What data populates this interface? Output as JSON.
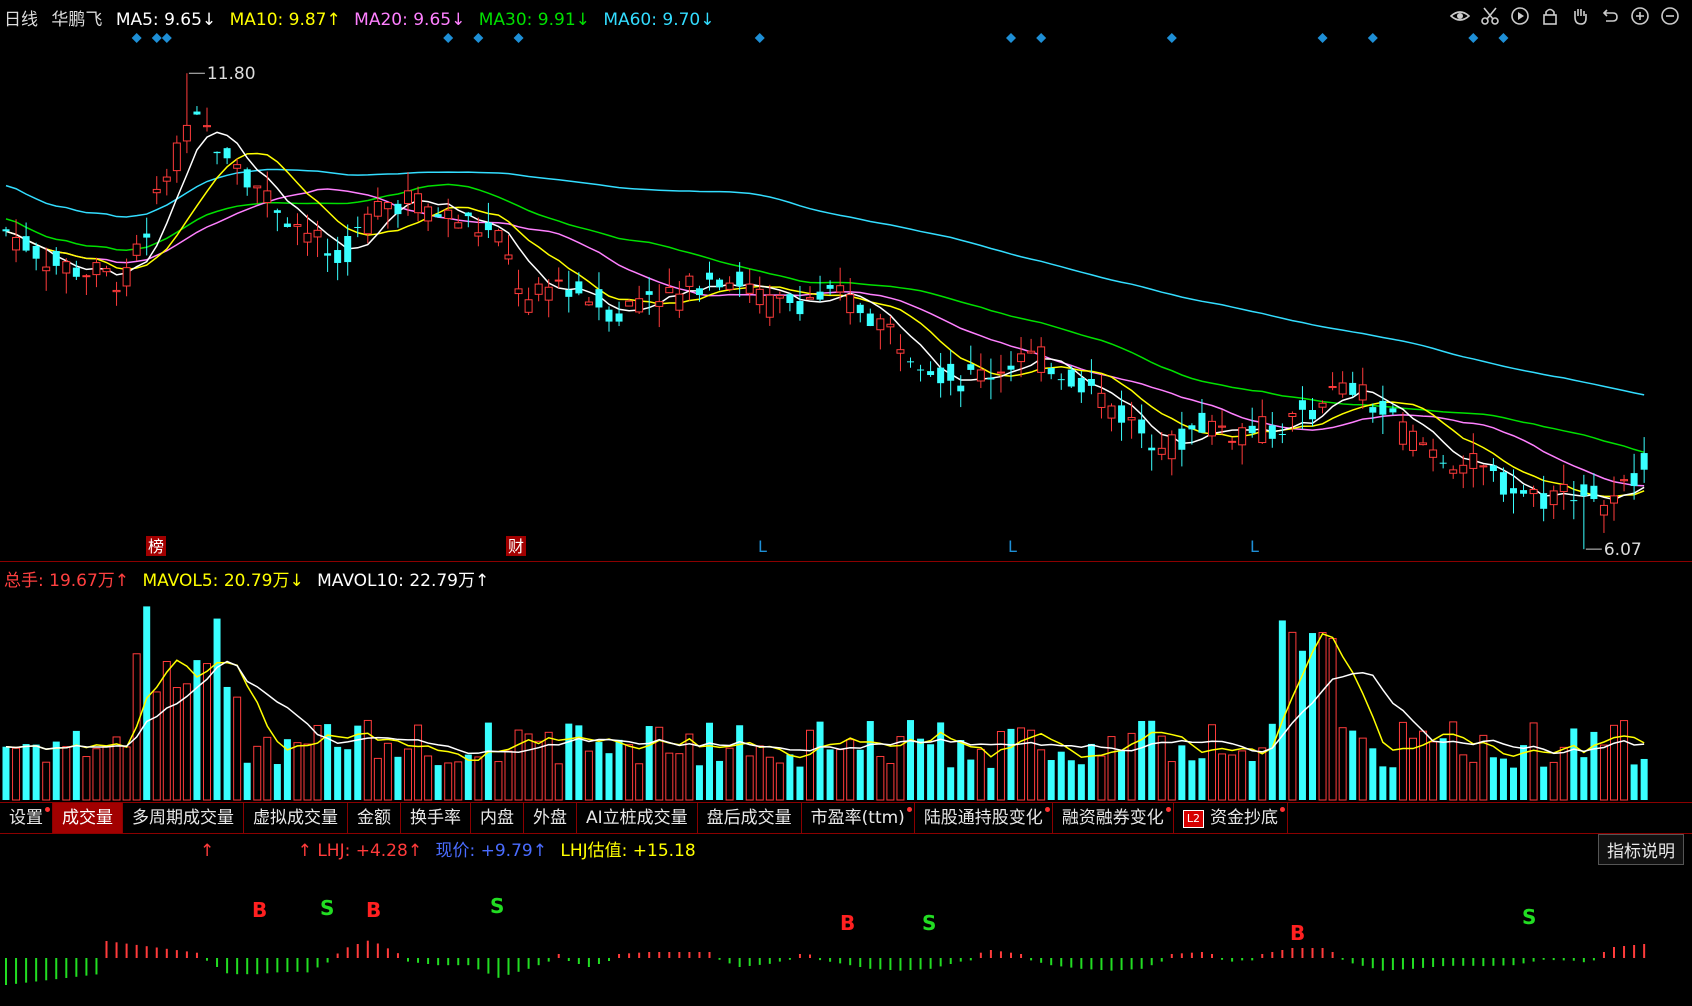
{
  "colors": {
    "up": "#ff3b3b",
    "down": "#39ffff",
    "ma5": "#ffffff",
    "ma10": "#ffff00",
    "ma20": "#ff80ff",
    "ma30": "#00e000",
    "ma60": "#33ddff",
    "vol_ma5": "#ffff00",
    "vol_ma10": "#ffffff",
    "diamond": "#1e8fd6",
    "lhj_up": "#ff3b3b",
    "lhj_down": "#22dd22",
    "price_text": "#4a6cff",
    "estimate_text": "#ffff00"
  },
  "header": {
    "period": "日线",
    "stock_name": "华鹏飞",
    "ma": [
      {
        "label": "MA5:",
        "value": "9.65↓"
      },
      {
        "label": "MA10:",
        "value": "9.87↑"
      },
      {
        "label": "MA20:",
        "value": "9.65↓"
      },
      {
        "label": "MA30:",
        "value": "9.91↓"
      },
      {
        "label": "MA60:",
        "value": "9.70↓"
      }
    ]
  },
  "toolbar": [
    "eye-icon",
    "scissors-icon",
    "play-icon",
    "lock-icon",
    "hand-icon",
    "undo-icon",
    "zoom-in-icon",
    "zoom-out-icon"
  ],
  "price_chart": {
    "high_label": "11.80",
    "low_label": "6.07",
    "markers": [
      "榜",
      "财",
      "L",
      "L",
      "L"
    ]
  },
  "volume_header": {
    "total": {
      "label": "总手:",
      "value": "19.67万↑"
    },
    "mavol5": {
      "label": "MAVOL5:",
      "value": "20.79万↓"
    },
    "mavol10": {
      "label": "MAVOL10:",
      "value": "22.79万↑"
    }
  },
  "tabs": [
    {
      "label": "设置",
      "dot": true
    },
    {
      "label": "成交量",
      "active": true
    },
    {
      "label": "多周期成交量"
    },
    {
      "label": "虚拟成交量"
    },
    {
      "label": "金额"
    },
    {
      "label": "换手率"
    },
    {
      "label": "内盘"
    },
    {
      "label": "外盘"
    },
    {
      "label": "AI立桩成交量"
    },
    {
      "label": "盘后成交量"
    },
    {
      "label": "市盈率(ttm)",
      "dot": true
    },
    {
      "label": "陆股通持股变化",
      "dot": true
    },
    {
      "label": "融资融券变化",
      "dot": true
    },
    {
      "label": "资金抄底",
      "dot": true,
      "badge": "L2"
    }
  ],
  "indicator": {
    "arrow": "↑",
    "lhj": {
      "label": "LHJ:",
      "value": "+4.28↑"
    },
    "price": {
      "label": "现价:",
      "value": "+9.79↑"
    },
    "estimate": {
      "label": "LHJ估值:",
      "value": "+15.18"
    },
    "help_label": "指标说明",
    "signals": [
      "B",
      "S",
      "B",
      "S",
      "B",
      "S",
      "B",
      "S"
    ]
  }
}
